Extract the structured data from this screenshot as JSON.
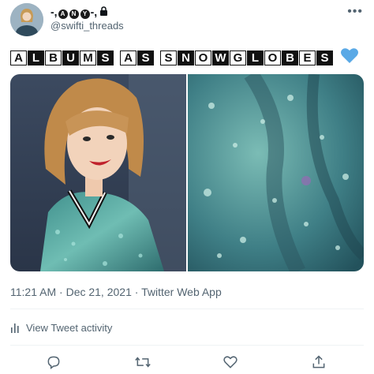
{
  "author": {
    "display_name_prefix": "-,",
    "display_name_circles": [
      "A",
      "N",
      "Y"
    ],
    "display_name_suffix": "-,",
    "handle": "@swifti_threads"
  },
  "more_label": "•••",
  "tweet": {
    "title_words": [
      {
        "letters": [
          {
            "c": "A",
            "s": "w"
          },
          {
            "c": "L",
            "s": "b"
          },
          {
            "c": "B",
            "s": "w"
          },
          {
            "c": "U",
            "s": "b"
          },
          {
            "c": "M",
            "s": "w"
          },
          {
            "c": "S",
            "s": "b"
          }
        ]
      },
      {
        "letters": [
          {
            "c": "A",
            "s": "w"
          },
          {
            "c": "S",
            "s": "b"
          }
        ]
      },
      {
        "letters": [
          {
            "c": "S",
            "s": "w"
          },
          {
            "c": "N",
            "s": "b"
          },
          {
            "c": "O",
            "s": "w"
          },
          {
            "c": "W",
            "s": "b"
          },
          {
            "c": "G",
            "s": "w"
          },
          {
            "c": "L",
            "s": "b"
          },
          {
            "c": "O",
            "s": "w"
          },
          {
            "c": "B",
            "s": "b"
          },
          {
            "c": "E",
            "s": "w"
          },
          {
            "c": "S",
            "s": "b"
          }
        ]
      }
    ],
    "emoji": "blue-heart"
  },
  "meta": {
    "time": "11:21 AM",
    "sep": " · ",
    "date": "Dec 21, 2021",
    "source": "Twitter Web App"
  },
  "activity_label": "View Tweet activity",
  "colors": {
    "accent_heart": "#5aa9e6",
    "muted_text": "#536471",
    "icon": "#536471",
    "divider": "#eff3f4"
  },
  "icons": {
    "reply": "speech-bubble-icon",
    "retweet": "retweet-icon",
    "like": "heart-outline-icon",
    "share": "share-upload-icon",
    "activity": "bar-chart-icon"
  }
}
